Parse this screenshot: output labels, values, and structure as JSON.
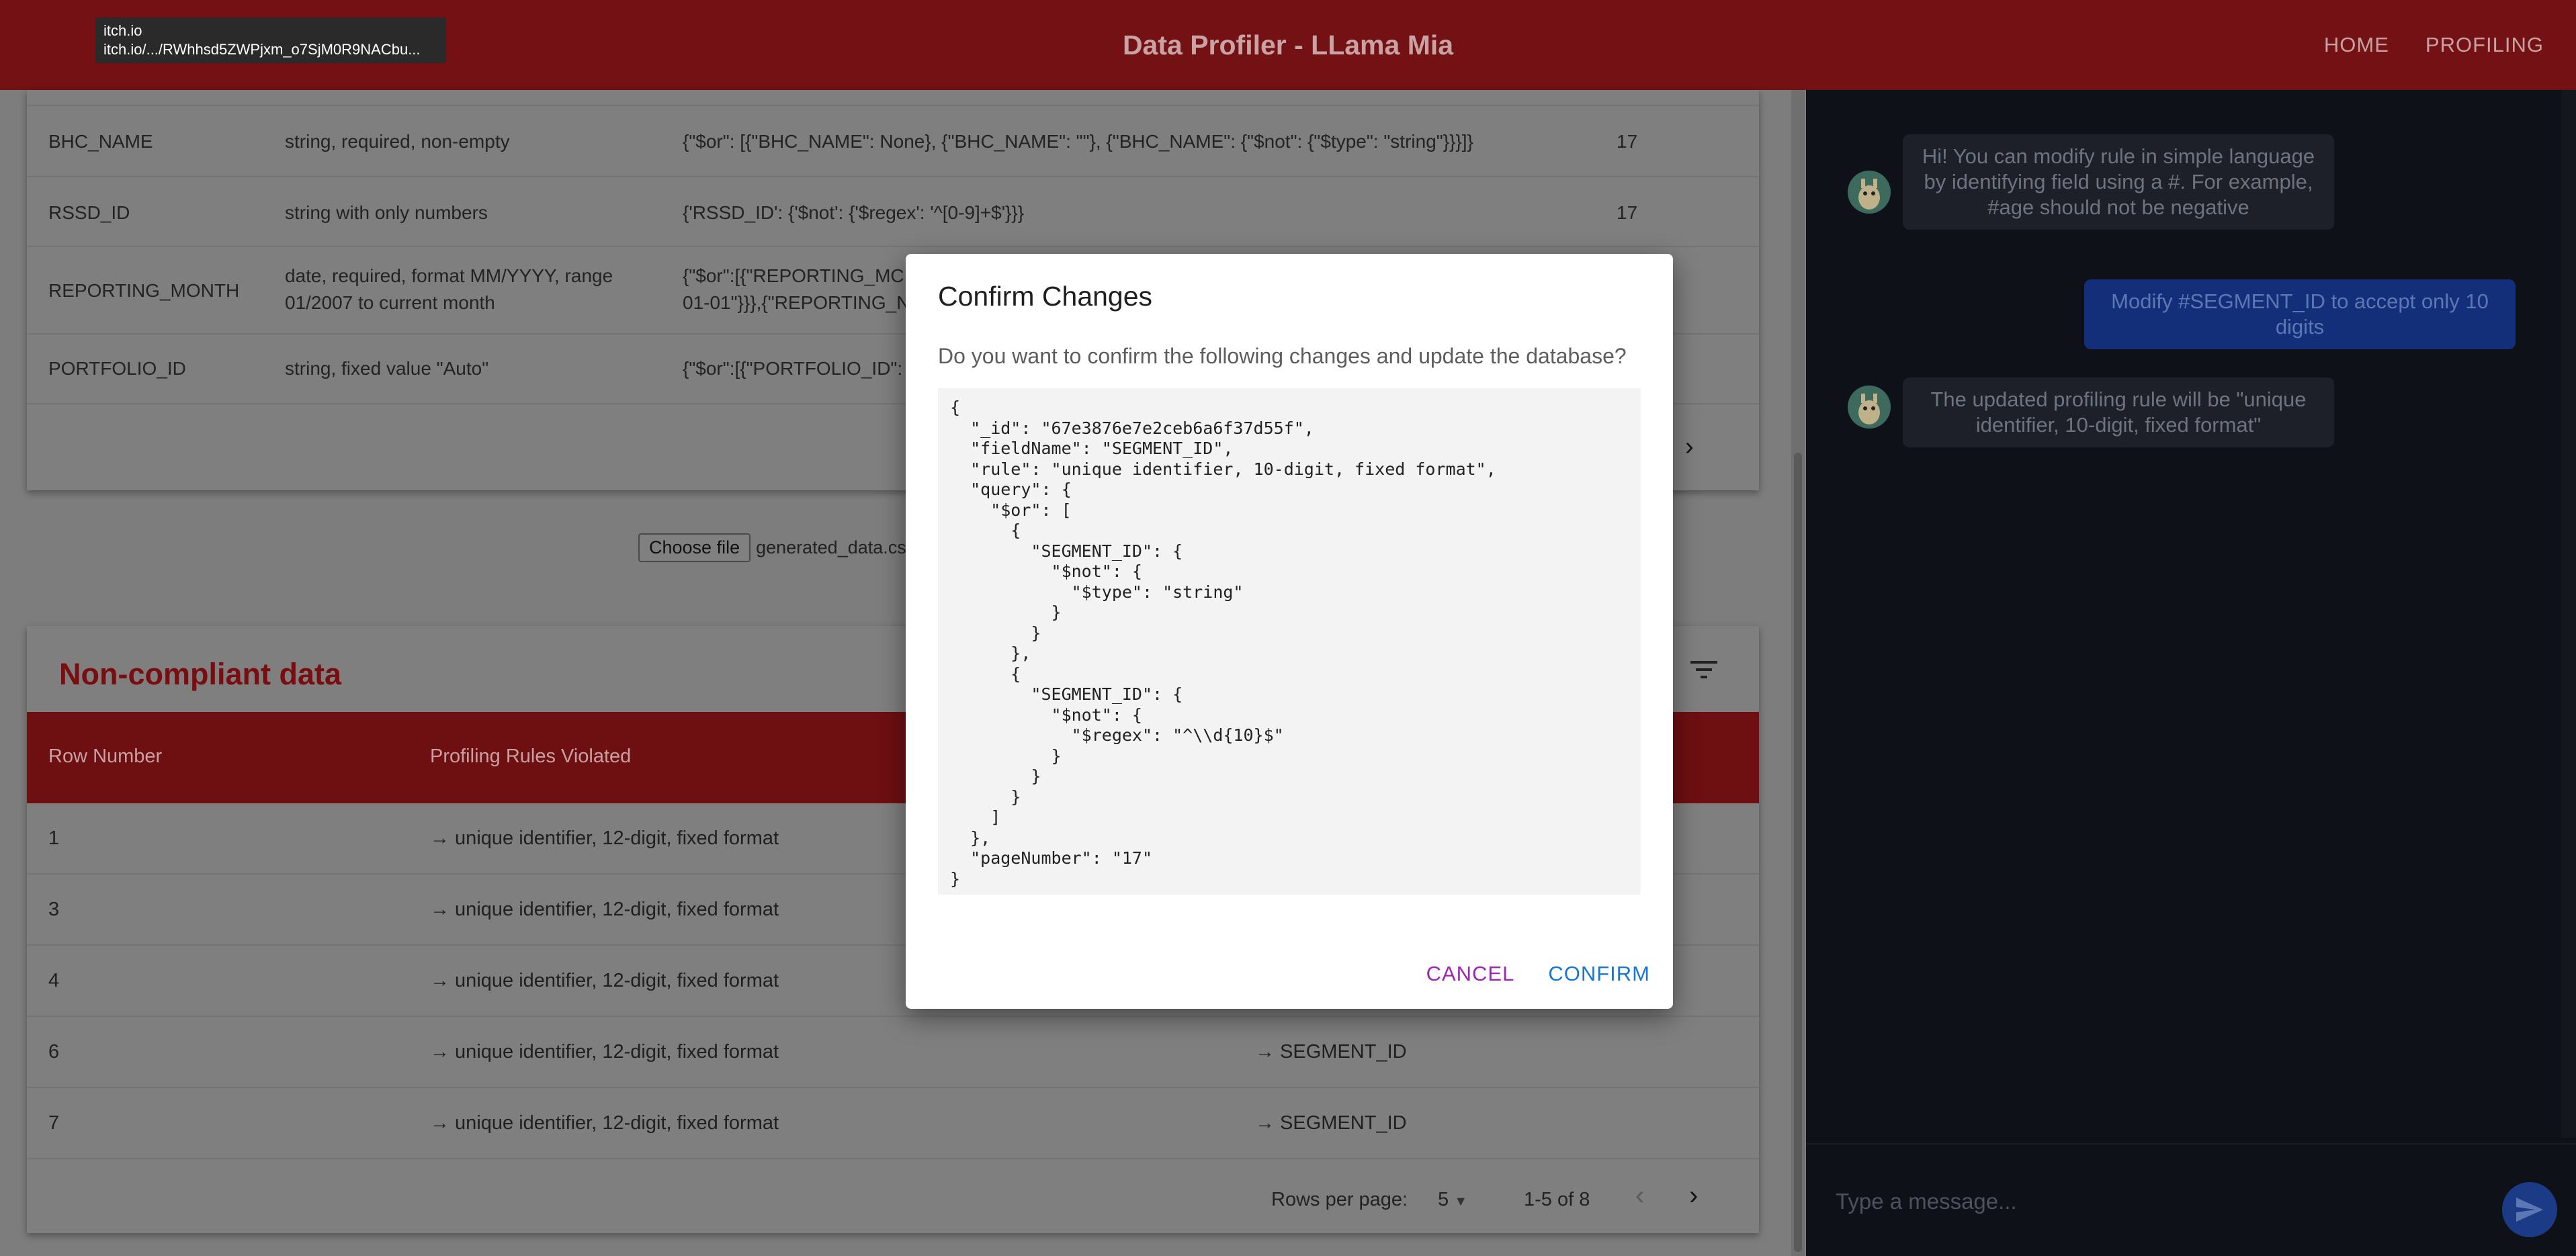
{
  "appbar": {
    "title": "Data Profiler - LLama Mia",
    "nav": [
      "HOME",
      "PROFILING"
    ]
  },
  "tooltip": {
    "line1": "itch.io",
    "line2": "itch.io/.../RWhhsd5ZWPjxm_o7SjM0R9NACbu..."
  },
  "rules_table": {
    "rows": [
      {
        "field": "BHC_NAME",
        "rule": "string, required, non-empty",
        "query": "{\"$or\": [{\"BHC_NAME\": None}, {\"BHC_NAME\": \"\"}, {\"BHC_NAME\": {\"$not\": {\"$type\": \"string\"}}}]}",
        "page": "17"
      },
      {
        "field": "RSSD_ID",
        "rule": "string with only numbers",
        "query": "{'RSSD_ID': {'$not': {'$regex': '^[0-9]+$'}}}",
        "page": "17"
      },
      {
        "field": "REPORTING_MONTH",
        "rule_line1": "date, required, format MM/YYYY, range",
        "rule_line2": "01/2007 to current month",
        "query_line1": "{\"$or\":[{\"REPORTING_MC",
        "query_line2": "01-01\"}}},{\"REPORTING_N",
        "page": ""
      },
      {
        "field": "PORTFOLIO_ID",
        "rule": "string, fixed value \"Auto\"",
        "query": "{\"$or\":[{\"PORTFOLIO_ID\":",
        "page": ""
      }
    ]
  },
  "file_input": {
    "button_label": "Choose file",
    "filename": "generated_data.csv"
  },
  "noncompliant": {
    "title": "Non-compliant data",
    "headers": [
      "Row Number",
      "Profiling Rules Violated"
    ],
    "rows": [
      {
        "row": "1",
        "rule": "→ unique identifier, 12-digit, fixed format",
        "field": ""
      },
      {
        "row": "3",
        "rule": "→ unique identifier, 12-digit, fixed format",
        "field": ""
      },
      {
        "row": "4",
        "rule": "→ unique identifier, 12-digit, fixed format",
        "field": ""
      },
      {
        "row": "6",
        "rule": "→ unique identifier, 12-digit, fixed format",
        "field": "→ SEGMENT_ID"
      },
      {
        "row": "7",
        "rule": "→ unique identifier, 12-digit, fixed format",
        "field": "→ SEGMENT_ID"
      }
    ],
    "footer": {
      "rows_per_page_label": "Rows per page:",
      "rows_per_page_value": "5",
      "range": "1-5 of 8"
    }
  },
  "chat": {
    "messages": [
      {
        "from": "bot",
        "text": "Hi! You can modify rule in simple language by identifying field using a #. For example, #age should not be negative"
      },
      {
        "from": "user",
        "text": "Modify #SEGMENT_ID to accept only 10 digits"
      },
      {
        "from": "bot",
        "text": "The updated profiling rule will be \"unique identifier, 10-digit, fixed format\""
      }
    ],
    "input_placeholder": "Type a message..."
  },
  "modal": {
    "title": "Confirm Changes",
    "question": "Do you want to confirm the following changes and update the database?",
    "code": "{\n  \"_id\": \"67e3876e7e2ceb6a6f37d55f\",\n  \"fieldName\": \"SEGMENT_ID\",\n  \"rule\": \"unique identifier, 10-digit, fixed format\",\n  \"query\": {\n    \"$or\": [\n      {\n        \"SEGMENT_ID\": {\n          \"$not\": {\n            \"$type\": \"string\"\n          }\n        }\n      },\n      {\n        \"SEGMENT_ID\": {\n          \"$not\": {\n            \"$regex\": \"^\\\\d{10}$\"\n          }\n        }\n      }\n    ]\n  },\n  \"pageNumber\": \"17\"\n}",
    "cancel_label": "CANCEL",
    "confirm_label": "CONFIRM"
  },
  "colors": {
    "brand": "#741114",
    "cancel": "#9c27b0",
    "confirm": "#1976d2",
    "chat_bg": "#0f1119"
  }
}
